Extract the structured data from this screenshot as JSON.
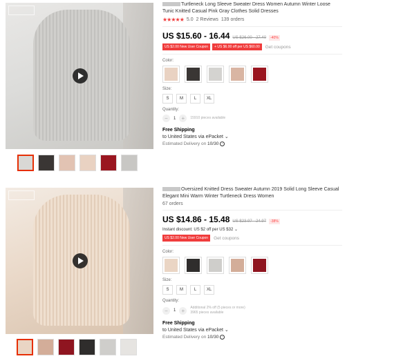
{
  "listings": [
    {
      "title": "Turtleneck Long Sleeve Sweater Dress Women Autumn Winter Loose Tunic Knitted Casual Pink Gray Clothes Solid Dresses",
      "rating_stars": "★★★★★",
      "rating": "5.0",
      "reviews": "2 Reviews",
      "orders": "139 orders",
      "price": "US $15.60 - 16.44",
      "price_old": "US $26.00 - 27.40",
      "discount": "-40%",
      "coupons": [
        "US $2.00 New User Coupon",
        "US $6.00 off per US $60.00"
      ],
      "get_coupons": "Get coupons",
      "color_label": "Color:",
      "colors": [
        "#e9d2c2",
        "#3a3634",
        "#d4d3d0",
        "#d9b5a3",
        "#9a1620"
      ],
      "size_label": "Size:",
      "sizes": [
        "S",
        "M",
        "L",
        "XL"
      ],
      "quantity_label": "Quantity:",
      "quantity": "1",
      "qty_note": "15910 pieces available",
      "shipping_title": "Free Shipping",
      "shipping_to": "to United States via ePacket",
      "delivery_label": "Estimated Delivery on",
      "delivery_date": "10/30"
    },
    {
      "title": "Oversized Knitted Dress Sweater Autumn 2019 Solid Long Sleeve Casual Elegant Mini Warm Winter Turtleneck Dress Women",
      "orders": "67 orders",
      "price": "US $14.86 - 15.48",
      "price_old": "US $23.97 - 24.97",
      "discount": "-38%",
      "instant": "Instant discount: US $2 off per US $32",
      "coupons": [
        "US $2.00 New User Coupon"
      ],
      "get_coupons": "Get coupons",
      "color_label": "Color:",
      "colors": [
        "#ead5c4",
        "#2f2d2c",
        "#cfcecb",
        "#d3ad99",
        "#8f1520"
      ],
      "size_label": "Size:",
      "sizes": [
        "S",
        "M",
        "L",
        "XL"
      ],
      "quantity_label": "Quantity:",
      "quantity": "1",
      "qty_note_1": "Additional 2% off (5 pieces or more)",
      "qty_note_2": "3965 pieces available",
      "shipping_title": "Free Shipping",
      "shipping_to": "to United States via ePacket",
      "delivery_label": "Estimated Delivery on",
      "delivery_date": "10/30"
    }
  ]
}
